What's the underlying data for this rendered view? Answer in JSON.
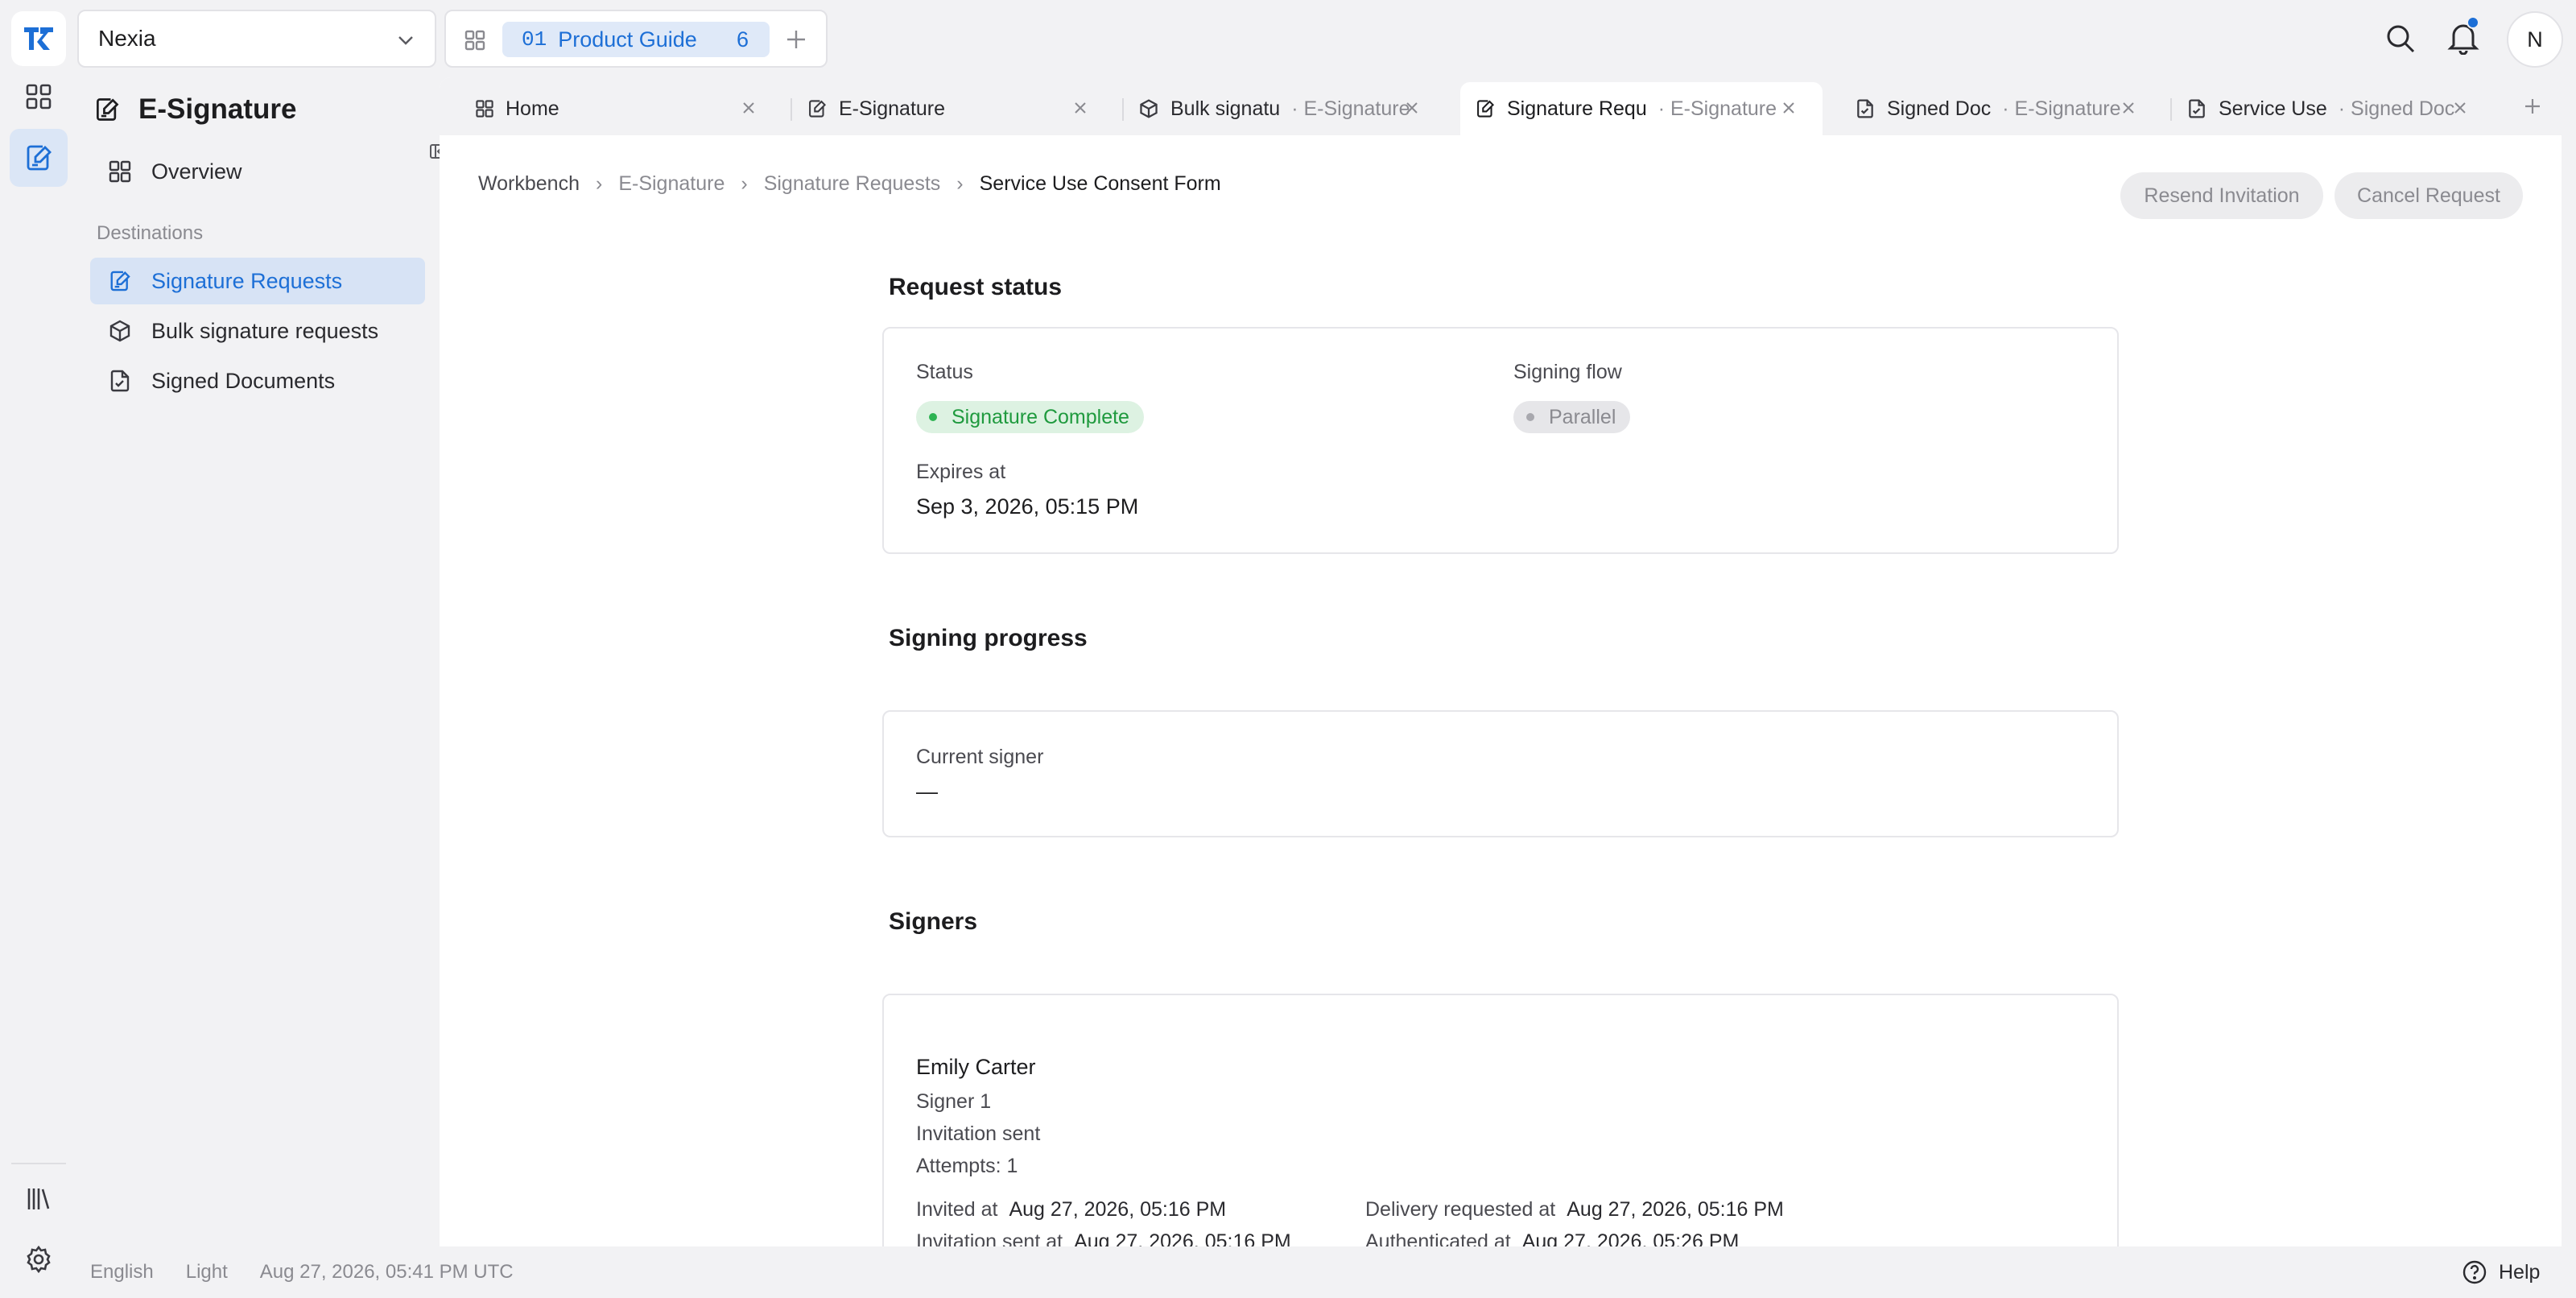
{
  "topbar": {
    "workspace": "Nexia",
    "tab_group": {
      "index": "01",
      "name": "Product Guide",
      "count": "6"
    },
    "avatar_initial": "N"
  },
  "sidebar": {
    "title": "E-Signature",
    "overview": "Overview",
    "section_label": "Destinations",
    "items": [
      {
        "label": "Signature Requests",
        "active": true
      },
      {
        "label": "Bulk signature requests",
        "active": false
      },
      {
        "label": "Signed Documents",
        "active": false
      }
    ]
  },
  "tabs": [
    {
      "title": "Home",
      "sub": ""
    },
    {
      "title": "E-Signature",
      "sub": ""
    },
    {
      "title": "Bulk signatu",
      "sub": "· E-Signature"
    },
    {
      "title": "Signature Requ",
      "sub": "· E-Signature"
    },
    {
      "title": "Signed Doc",
      "sub": "· E-Signature"
    },
    {
      "title": "Service Use",
      "sub": "· Signed Doc"
    }
  ],
  "breadcrumb": [
    "Workbench",
    "E-Signature",
    "Signature Requests",
    "Service Use Consent Form"
  ],
  "actions": {
    "resend": "Resend Invitation",
    "cancel": "Cancel Request"
  },
  "request_status": {
    "title": "Request status",
    "status_label": "Status",
    "status_value": "Signature Complete",
    "flow_label": "Signing flow",
    "flow_value": "Parallel",
    "expires_label": "Expires at",
    "expires_value": "Sep 3, 2026, 05:15 PM"
  },
  "signing_progress": {
    "title": "Signing progress",
    "current_label": "Current signer",
    "current_value": "—"
  },
  "signers": {
    "title": "Signers",
    "list": [
      {
        "name": "Emily Carter",
        "role": "Signer 1",
        "state": "Invitation sent",
        "attempts": "Attempts: 1",
        "invited_label": "Invited at",
        "invited_value": "Aug 27, 2026, 05:16 PM",
        "delivery_label": "Delivery requested at",
        "delivery_value": "Aug 27, 2026, 05:16 PM",
        "sent_label": "Invitation sent at",
        "sent_value": "Aug 27, 2026, 05:16 PM",
        "auth_label": "Authenticated at",
        "auth_value": "Aug 27, 2026, 05:26 PM"
      }
    ]
  },
  "footer": {
    "language": "English",
    "theme": "Light",
    "timestamp": "Aug 27, 2026, 05:41 PM UTC",
    "help": "Help"
  },
  "colors": {
    "accent": "#1d6fd6",
    "success": "#1f9a3e",
    "background": "#f2f2f4"
  }
}
